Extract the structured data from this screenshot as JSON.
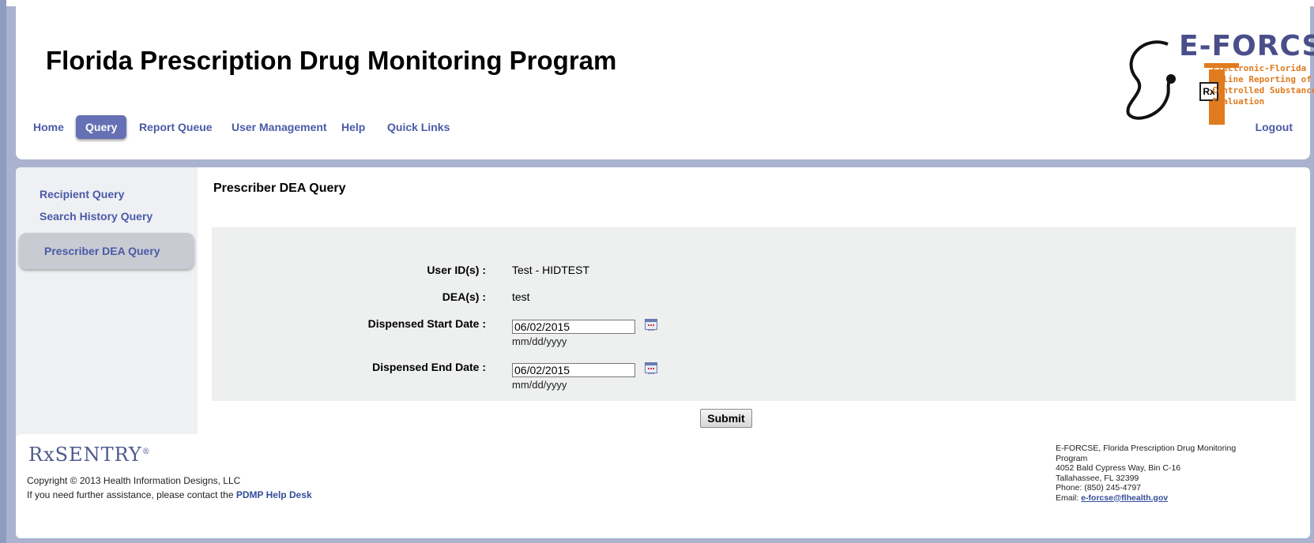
{
  "header": {
    "title": "Florida Prescription Drug Monitoring Program",
    "logo": {
      "name": "E-FORCSE",
      "lines": [
        "Electronic-Florida",
        "Online Reporting of",
        "Controlled Substances",
        "Evaluation"
      ],
      "rx_badge": "Rx"
    }
  },
  "nav": {
    "items": [
      {
        "label": "Home",
        "active": false
      },
      {
        "label": "Query",
        "active": true
      },
      {
        "label": "Report Queue",
        "active": false
      },
      {
        "label": "User Management",
        "active": false
      },
      {
        "label": "Help",
        "active": false
      },
      {
        "label": "Quick Links",
        "active": false
      }
    ],
    "logout": "Logout"
  },
  "sidebar": {
    "items": [
      {
        "label": "Recipient Query",
        "active": false
      },
      {
        "label": "Search History Query",
        "active": false
      },
      {
        "label": "Prescriber DEA Query",
        "active": true
      }
    ]
  },
  "main": {
    "title": "Prescriber DEA Query",
    "form": {
      "user_ids_label": "User ID(s) :",
      "user_ids_value": "Test - HIDTEST",
      "dea_label": "DEA(s) :",
      "dea_value": "test",
      "start_label": "Dispensed Start Date :",
      "start_value": "06/02/2015",
      "start_hint": "mm/dd/yyyy",
      "end_label": "Dispensed End Date :",
      "end_value": "06/02/2015",
      "end_hint": "mm/dd/yyyy"
    },
    "submit_label": "Submit"
  },
  "footer": {
    "logo_text": "RxSENTRY",
    "logo_mark": "®",
    "copyright": "Copyright © 2013 Health Information Designs, LLC",
    "assist_text": "If you need further assistance, please contact the ",
    "help_link": "PDMP Help Desk",
    "contact": {
      "org": "E-FORCSE, Florida Prescription Drug Monitoring Program",
      "address1": "4052 Bald Cypress Way, Bin C-16",
      "address2": "Tallahassee, FL 32399",
      "phone": "Phone: (850) 245-4797",
      "email_label": "Email: ",
      "email": "e-forcse@flhealth.gov"
    }
  },
  "colors": {
    "accent": "#6670b4",
    "link": "#4b5aa6",
    "logo_orange": "#e07b1e"
  },
  "icons": [
    "calendar-icon",
    "stethoscope-icon"
  ]
}
